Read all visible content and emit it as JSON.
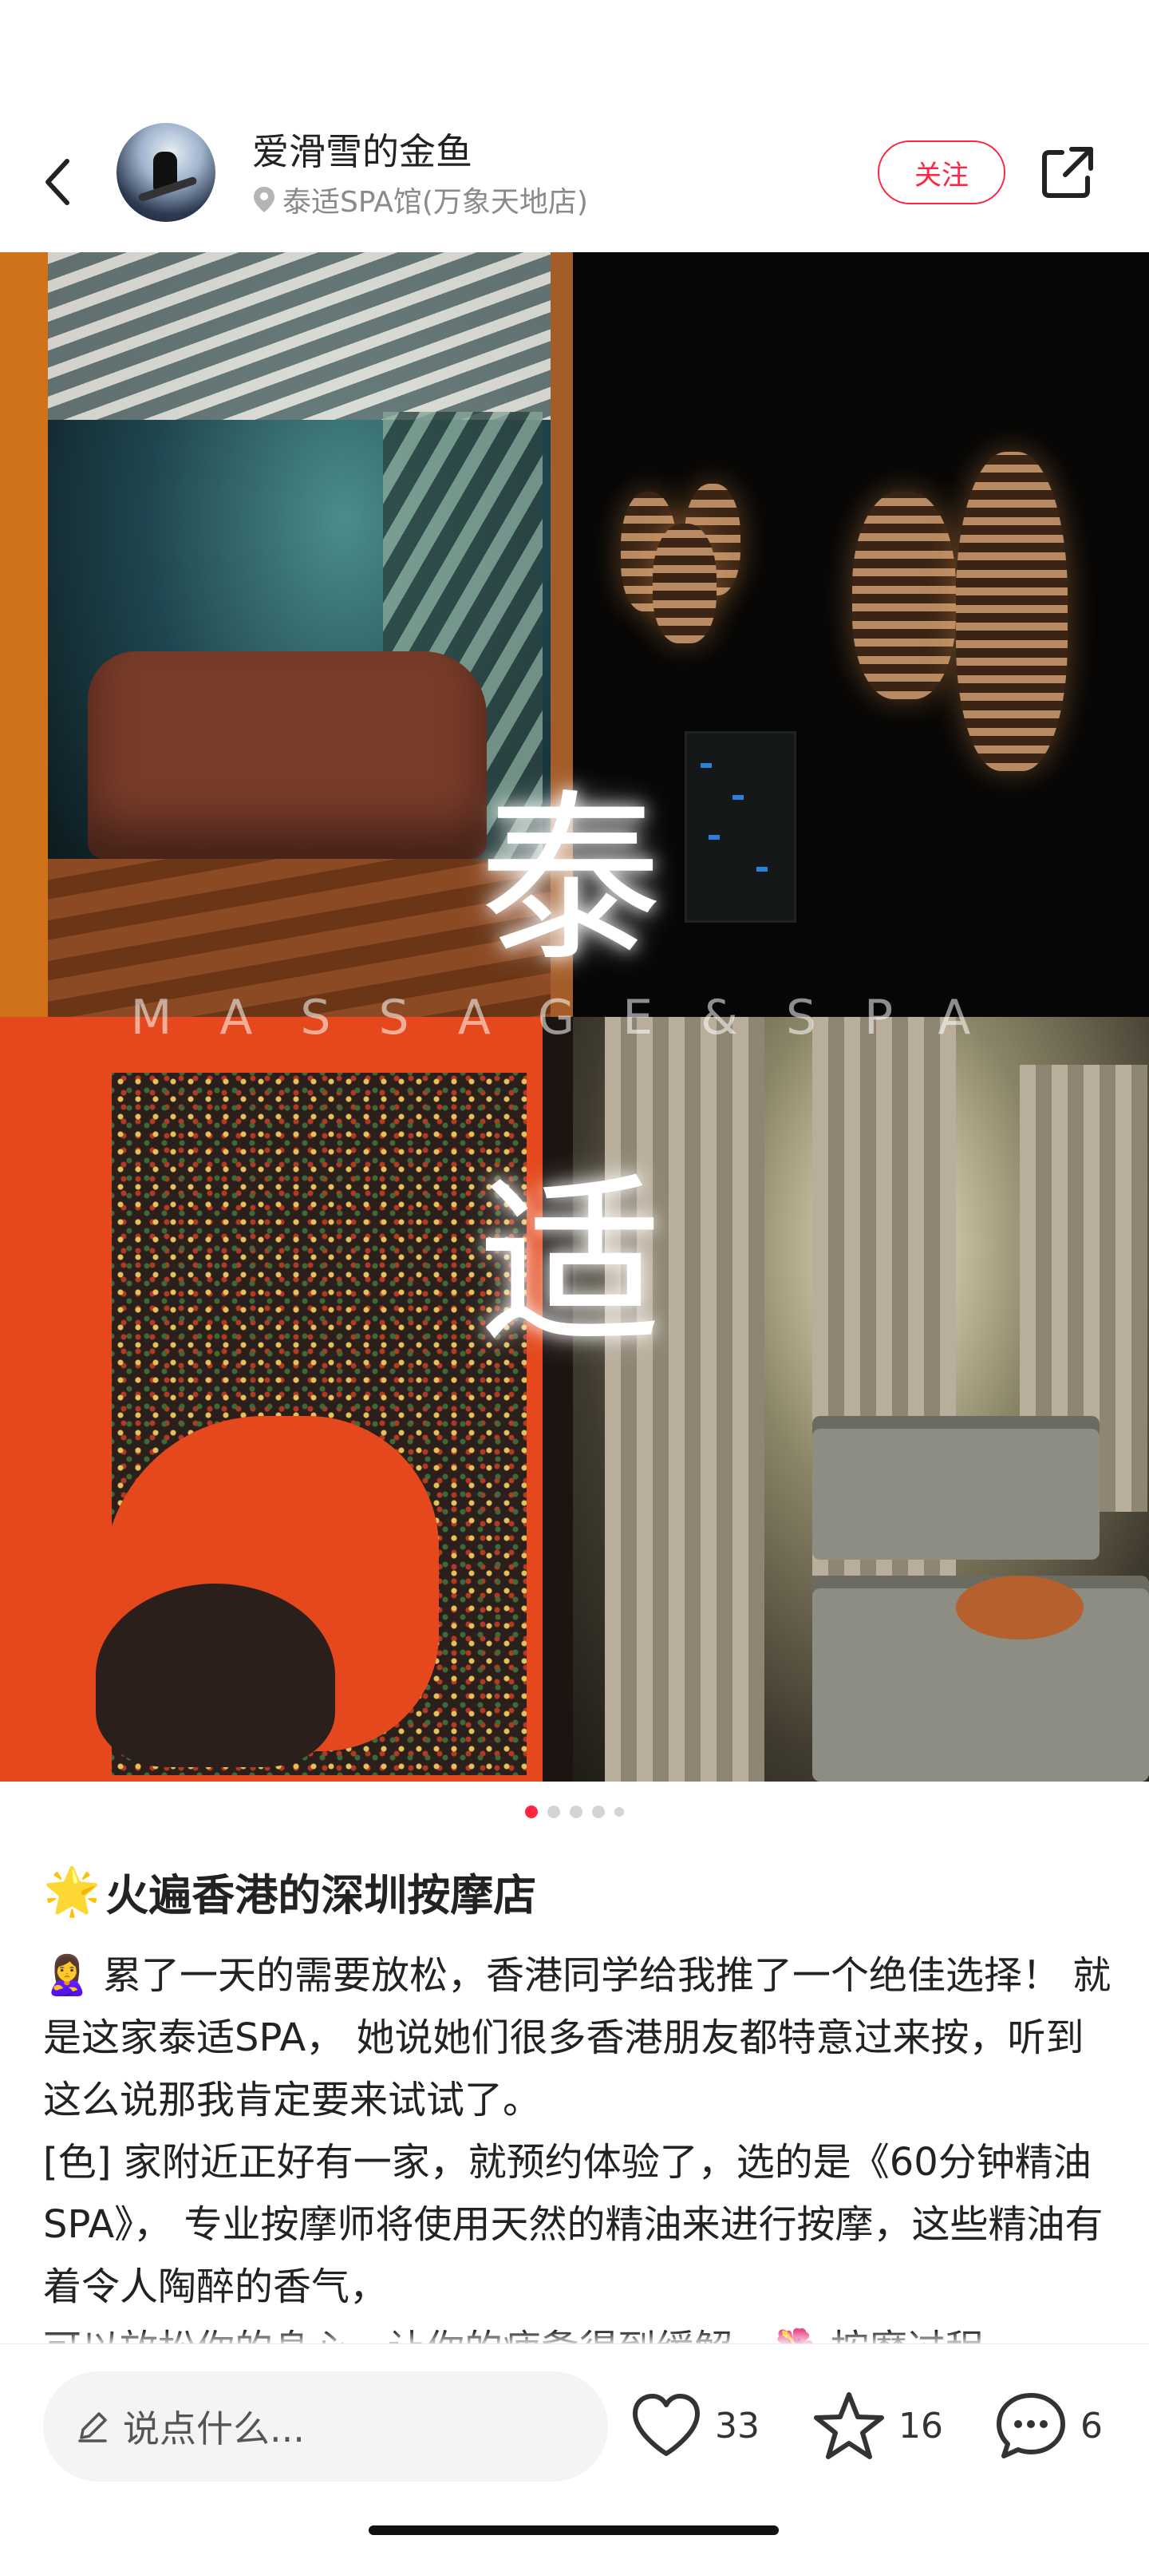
{
  "header": {
    "author_name": "爱滑雪的金鱼",
    "location": "泰适SPA馆(万象天地店)",
    "follow_label": "关注"
  },
  "hero": {
    "title_char_1": "泰",
    "title_char_2": "适",
    "subtitle": "MASSAGE&SPA",
    "page_count": 5,
    "current_page": 1
  },
  "post": {
    "title": "火遍香港的深圳按摩店",
    "title_emoji": "🌟",
    "paragraphs": [
      "🙎‍♀️ 累了一天的需要放松，香港同学给我推了一个绝佳选择！ 就是这家泰适SPA， 她说她们很多香港朋友都特意过来按，听到这么说那我肯定要来试试了。",
      "[色] 家附近正好有一家，就预约体验了，选的是《60分钟精油SPA》， 专业按摩师将使用天然的精油来进行按摩，这些精油有着令人陶醉的香气，",
      "可以放松你的身心，让你的疲惫得到缓解。🌺 按摩过程"
    ]
  },
  "bottom_bar": {
    "comment_placeholder": "说点什么...",
    "like_count": "33",
    "favorite_count": "16",
    "comment_count": "6"
  },
  "colors": {
    "accent": "#ff2442",
    "text": "#222222",
    "muted": "#8a8a8a"
  }
}
